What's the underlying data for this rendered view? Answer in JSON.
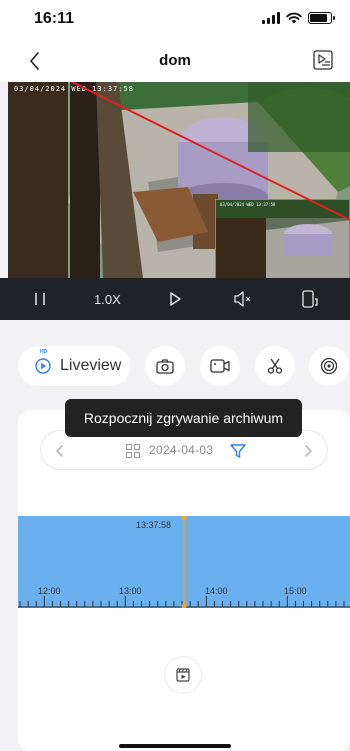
{
  "status_bar": {
    "time": "16:11"
  },
  "nav": {
    "title": "dom"
  },
  "video": {
    "osd_main": "03/04/2024 WED 13:37:58",
    "osd_pip": "03/04/2024 WED 13:37:58"
  },
  "controls": {
    "zoom_label": "1.0X"
  },
  "actions": {
    "liveview_label": "Liveview",
    "liveview_badge": "HD"
  },
  "tooltip": {
    "text": "Rozpocznij zgrywanie archiwum"
  },
  "date_picker": {
    "date": "2024-04-03"
  },
  "timeline": {
    "playhead_time": "13:37:58",
    "ticks": [
      {
        "label": "12:00"
      },
      {
        "label": "13:00"
      },
      {
        "label": "14:00"
      },
      {
        "label": "15:00"
      }
    ]
  },
  "colors": {
    "accent": "#2f80ed",
    "timeline_fill": "#6ab0ef",
    "playhead": "#f5a623",
    "annotation_line": "#e02020",
    "controls_bg": "#1f2226"
  },
  "icons": {
    "back": "chevron-left-icon",
    "playlist": "playlist-icon",
    "pause": "pause-icon",
    "play": "play-icon",
    "mute": "speaker-mute-icon",
    "fullscreen": "rotate-screen-icon",
    "snapshot": "camera-icon",
    "record": "video-record-icon",
    "clip": "scissors-icon",
    "fisheye": "lens-icon",
    "date_prev": "chevron-left-icon",
    "date_next": "chevron-right-icon",
    "grid": "grid-icon",
    "filter": "filter-icon",
    "archive": "film-icon"
  }
}
